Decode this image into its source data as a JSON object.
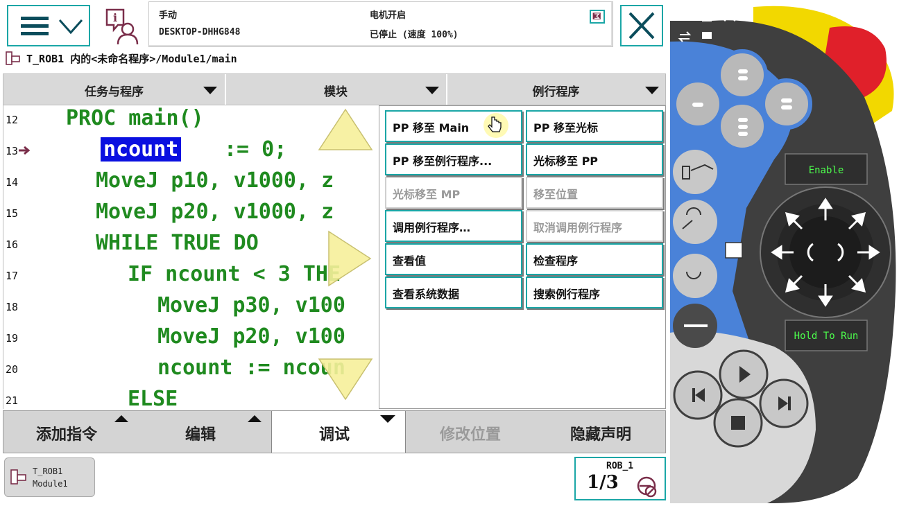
{
  "status": {
    "mode": "手动",
    "host": "DESKTOP-DHHG848",
    "motor": "电机开启",
    "state": "已停止 (速度 100%)"
  },
  "breadcrumb": "T_ROB1 内的<未命名程序>/Module1/main",
  "tabs": [
    {
      "label": "任务与程序"
    },
    {
      "label": "模块"
    },
    {
      "label": "例行程序"
    }
  ],
  "code": {
    "line_numbers": [
      "12",
      "13",
      "14",
      "15",
      "16",
      "17",
      "18",
      "19",
      "20",
      "21"
    ],
    "lines": [
      "PROC main()",
      "ncount",
      ":= 0;",
      "MoveJ p10, v1000, z",
      "MoveJ p20, v1000, z",
      "WHILE TRUE DO",
      "IF ncount < 3 THE",
      "MoveJ p30, v100",
      "MoveJ p20, v100",
      "ncount := ncoun",
      "ELSE"
    ]
  },
  "popup": {
    "items": [
      {
        "label": "PP 移至 Main",
        "enabled": true
      },
      {
        "label": "PP 移至光标",
        "enabled": true
      },
      {
        "label": "PP 移至例行程序...",
        "enabled": true
      },
      {
        "label": "光标移至 PP",
        "enabled": true
      },
      {
        "label": "光标移至 MP",
        "enabled": false
      },
      {
        "label": "移至位置",
        "enabled": false
      },
      {
        "label": "调用例行程序…",
        "enabled": true
      },
      {
        "label": "取消调用例行程序",
        "enabled": false
      },
      {
        "label": "查看值",
        "enabled": true
      },
      {
        "label": "检查程序",
        "enabled": true
      },
      {
        "label": "查看系统数据",
        "enabled": true
      },
      {
        "label": "搜索例行程序",
        "enabled": true
      }
    ]
  },
  "bottom": {
    "add_instruction": "添加指令",
    "edit": "编辑",
    "debug": "调试",
    "modify_position": "修改位置",
    "hide_declarations": "隐藏声明"
  },
  "taskbar": {
    "task": "T_ROB1",
    "module": "Module1",
    "rob": "ROB_1",
    "fraction": "1/3"
  },
  "pendant": {
    "enable_label": "Enable",
    "hold_to_run_label": "Hold To Run"
  },
  "colors": {
    "accent": "#1aa6a6",
    "code_green": "#1f8a1f",
    "highlight_blue": "#0a10e0",
    "pendant_blue": "#4a82d8"
  }
}
